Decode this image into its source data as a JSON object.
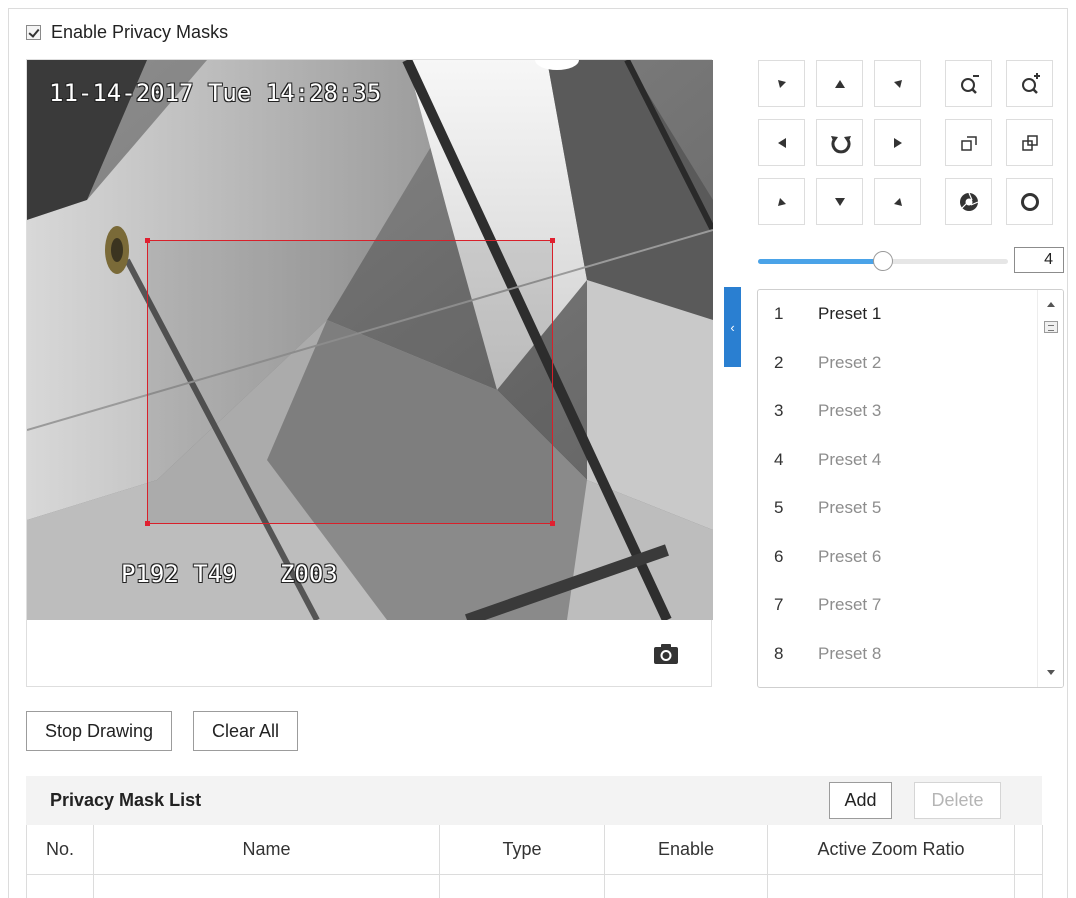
{
  "enable_privacy_masks": {
    "label": "Enable Privacy Masks",
    "checked": true
  },
  "video": {
    "osd_datetime": "11-14-2017 Tue 14:28:35",
    "osd_position": "P192 T49   Z003",
    "capture_icon": "camera-icon"
  },
  "ptz": {
    "buttons": [
      {
        "icon": "arrow-up-left-icon"
      },
      {
        "icon": "arrow-up-icon"
      },
      {
        "icon": "arrow-up-right-icon"
      },
      {
        "icon": "zoom-out-icon"
      },
      {
        "icon": "zoom-in-icon"
      },
      {
        "icon": "arrow-left-icon"
      },
      {
        "icon": "auto-scan-icon"
      },
      {
        "icon": "arrow-right-icon"
      },
      {
        "icon": "focus-near-icon"
      },
      {
        "icon": "focus-far-icon"
      },
      {
        "icon": "arrow-down-left-icon"
      },
      {
        "icon": "arrow-down-icon"
      },
      {
        "icon": "arrow-down-right-icon"
      },
      {
        "icon": "iris-close-icon"
      },
      {
        "icon": "iris-open-icon"
      }
    ],
    "speed": {
      "value": "4",
      "min": 1,
      "max": 7,
      "fill_fraction": 0.5
    }
  },
  "presets": {
    "items": [
      {
        "num": "1",
        "name": "Preset 1",
        "active": true
      },
      {
        "num": "2",
        "name": "Preset 2",
        "active": false
      },
      {
        "num": "3",
        "name": "Preset 3",
        "active": false
      },
      {
        "num": "4",
        "name": "Preset 4",
        "active": false
      },
      {
        "num": "5",
        "name": "Preset 5",
        "active": false
      },
      {
        "num": "6",
        "name": "Preset 6",
        "active": false
      },
      {
        "num": "7",
        "name": "Preset 7",
        "active": false
      },
      {
        "num": "8",
        "name": "Preset 8",
        "active": false
      }
    ]
  },
  "actions": {
    "stop_drawing": "Stop Drawing",
    "clear_all": "Clear All"
  },
  "mask_list": {
    "title": "Privacy Mask List",
    "add": "Add",
    "delete": "Delete",
    "columns": [
      "No.",
      "Name",
      "Type",
      "Enable",
      "Active Zoom Ratio"
    ]
  },
  "colors": {
    "accent": "#2a7fd1",
    "mask_border": "#d8202a",
    "slider_fill": "#4aa3e8"
  }
}
